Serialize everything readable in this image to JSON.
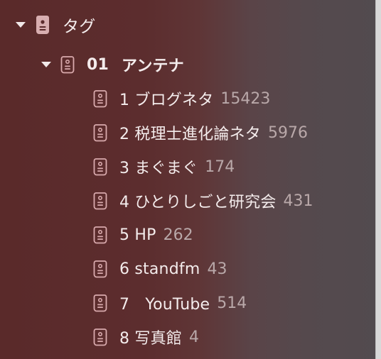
{
  "tree": {
    "root": {
      "label": "タグ"
    },
    "folder": {
      "number": "01",
      "name": "アンテナ"
    },
    "items": [
      {
        "label": "1 ブログネタ",
        "count": "15423"
      },
      {
        "label": "2 税理士進化論ネタ",
        "count": "5976"
      },
      {
        "label": "3 まぐまぐ",
        "count": "174"
      },
      {
        "label": "4 ひとりしごと研究会",
        "count": "431"
      },
      {
        "label": "5 HP",
        "count": "262"
      },
      {
        "label": "6 standfm",
        "count": "43"
      },
      {
        "label": "7　YouTube",
        "count": "514"
      },
      {
        "label": "8 写真館",
        "count": "4"
      }
    ]
  },
  "colors": {
    "text": "#f4ecec",
    "count_text": "#b9a8a9",
    "icon": "#d8aeb0",
    "icon_outline": "#d9aaad"
  },
  "icons": {
    "root_icon": "tag-filled-icon",
    "item_icon": "tag-outline-icon",
    "disclosure_icon": "triangle-down-icon"
  }
}
